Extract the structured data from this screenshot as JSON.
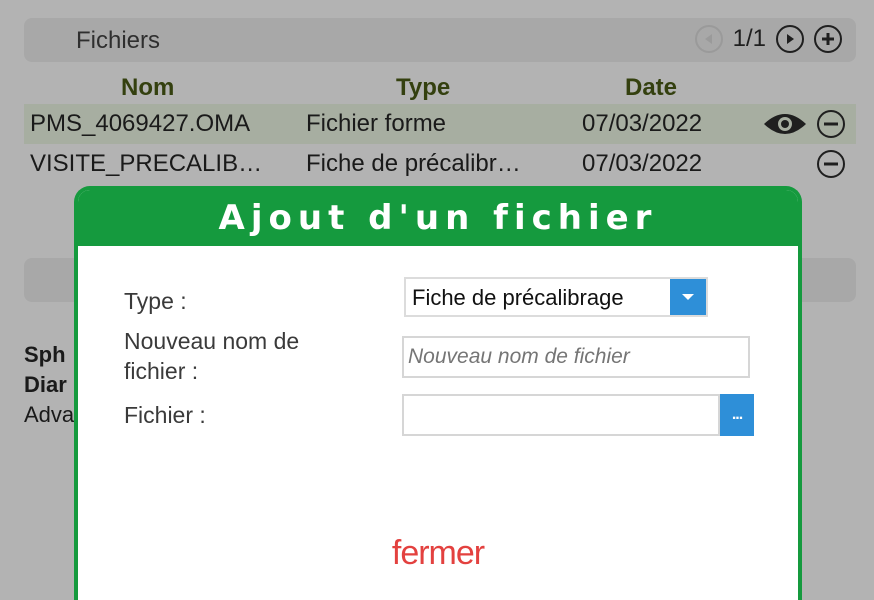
{
  "files": {
    "title": "Fichiers",
    "pager": "1/1",
    "columns": {
      "name": "Nom",
      "type": "Type",
      "date": "Date"
    },
    "rows": [
      {
        "name": "PMS_4069427.OMA",
        "type": "Fichier forme",
        "date": "07/03/2022",
        "selected": true
      },
      {
        "name": "VISITE_PRECALIB…",
        "type": "Fiche de précalibr…",
        "date": "07/03/2022",
        "selected": false
      }
    ]
  },
  "background": {
    "labels": [
      "Sph",
      "Diar",
      "Adva"
    ]
  },
  "modal": {
    "title": "Ajout d'un fichier",
    "type_label": "Type :",
    "type_value": "Fiche de précalibrage",
    "name_label": "Nouveau nom de fichier :",
    "name_placeholder": "Nouveau nom de fichier",
    "file_label": "Fichier :",
    "browse_label": "...",
    "close_label": "fermer"
  },
  "colors": {
    "accent_green": "#159a3e",
    "select_blue": "#2e8fd8",
    "close_red": "#e3413f"
  }
}
